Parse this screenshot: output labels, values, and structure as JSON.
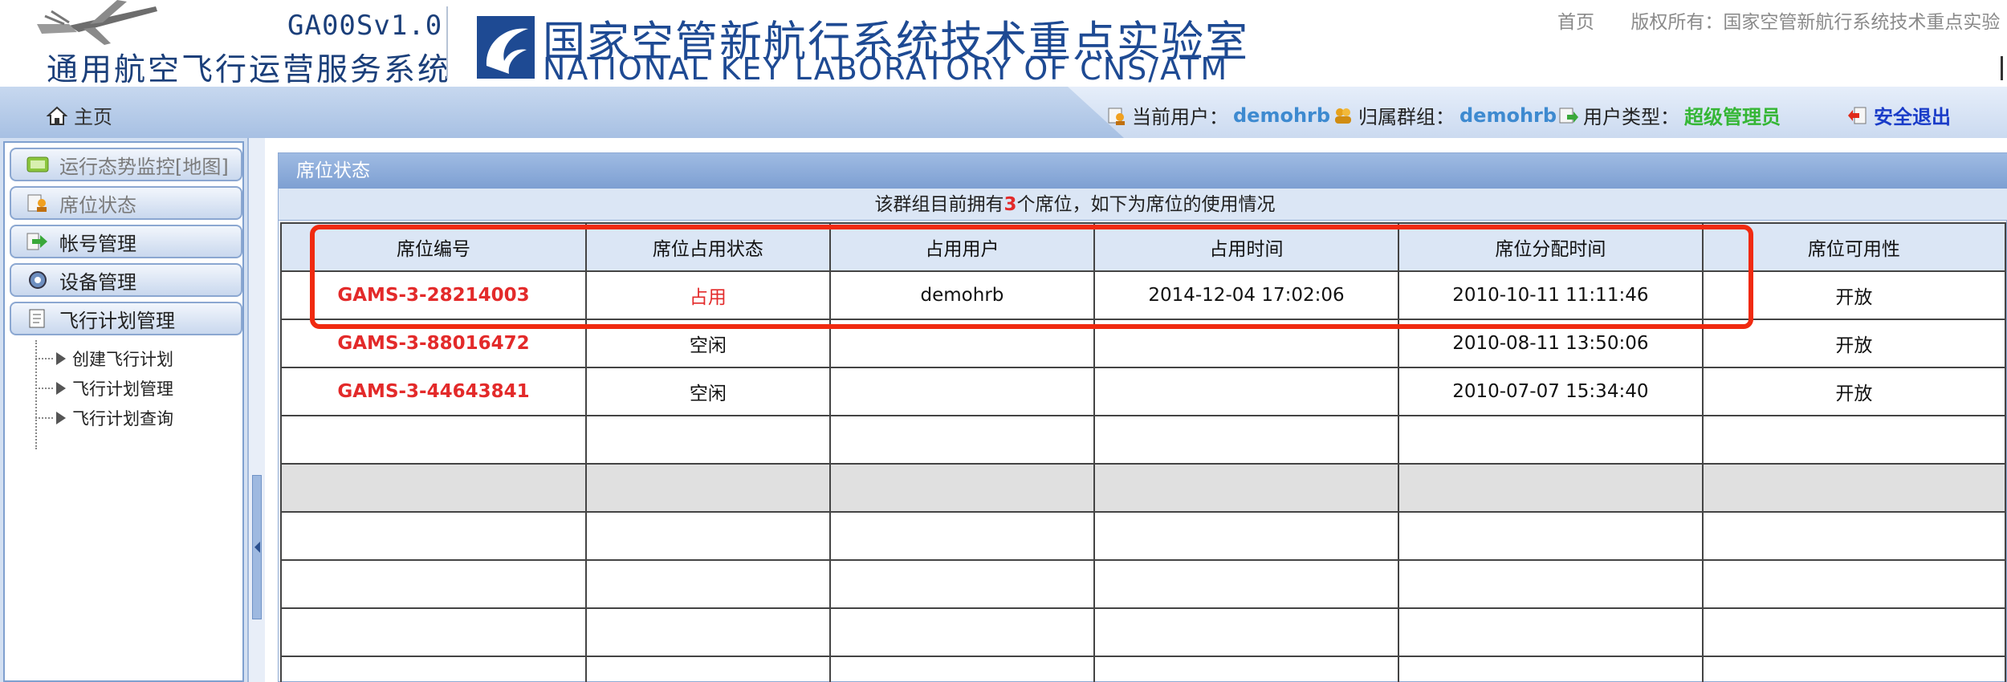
{
  "header": {
    "product_version": "GA00Sv1.0",
    "product_name": "通用航空飞行运营服务系统",
    "lab_name_cn": "国家空管新航行系统技术重点实验室",
    "lab_name_en": "NATIONAL KEY LABORATORY OF CNS/ATM",
    "top_links": {
      "home": "首页",
      "copyright": "版权所有：国家空管新航行系统技术重点实验"
    }
  },
  "userbar": {
    "home_label": "主页",
    "current_user_label": "当前用户：",
    "current_user": "demohrb",
    "group_label": "归属群组：",
    "group": "demohrb",
    "user_type_label": "用户类型：",
    "user_type": "超级管理员",
    "logout_label": "安全退出"
  },
  "sidebar": {
    "items": [
      {
        "label": "运行态势监控[地图]",
        "icon": "monitor-icon"
      },
      {
        "label": "席位状态",
        "icon": "seat-user-icon"
      },
      {
        "label": "帐号管理",
        "icon": "arrow-right-icon"
      },
      {
        "label": "设备管理",
        "icon": "gear-icon"
      },
      {
        "label": "飞行计划管理",
        "icon": "document-icon"
      }
    ],
    "tree": [
      {
        "label": "创建飞行计划"
      },
      {
        "label": "飞行计划管理"
      },
      {
        "label": "飞行计划查询"
      }
    ]
  },
  "panel": {
    "title": "席位状态",
    "summary_prefix": "该群组目前拥有",
    "summary_count": "3",
    "summary_suffix": "个席位，如下为席位的使用情况",
    "columns": [
      "席位编号",
      "席位占用状态",
      "占用用户",
      "占用时间",
      "席位分配时间",
      "席位可用性"
    ],
    "rows": [
      [
        "GAMS-3-28214003",
        "占用",
        "demohrb",
        "2014-12-04 17:02:06",
        "2010-10-11 11:11:46",
        "开放"
      ],
      [
        "GAMS-3-88016472",
        "空闲",
        "",
        "",
        "2010-08-11 13:50:06",
        "开放"
      ],
      [
        "GAMS-3-44643841",
        "空闲",
        "",
        "",
        "2010-07-07 15:34:40",
        "开放"
      ]
    ]
  },
  "colors": {
    "accent_blue": "#1e4a93",
    "seat_id_red": "#e32a2a",
    "user_value_blue": "#3e8ad0",
    "admin_green": "#35b635",
    "highlight_red": "#f02a10"
  }
}
